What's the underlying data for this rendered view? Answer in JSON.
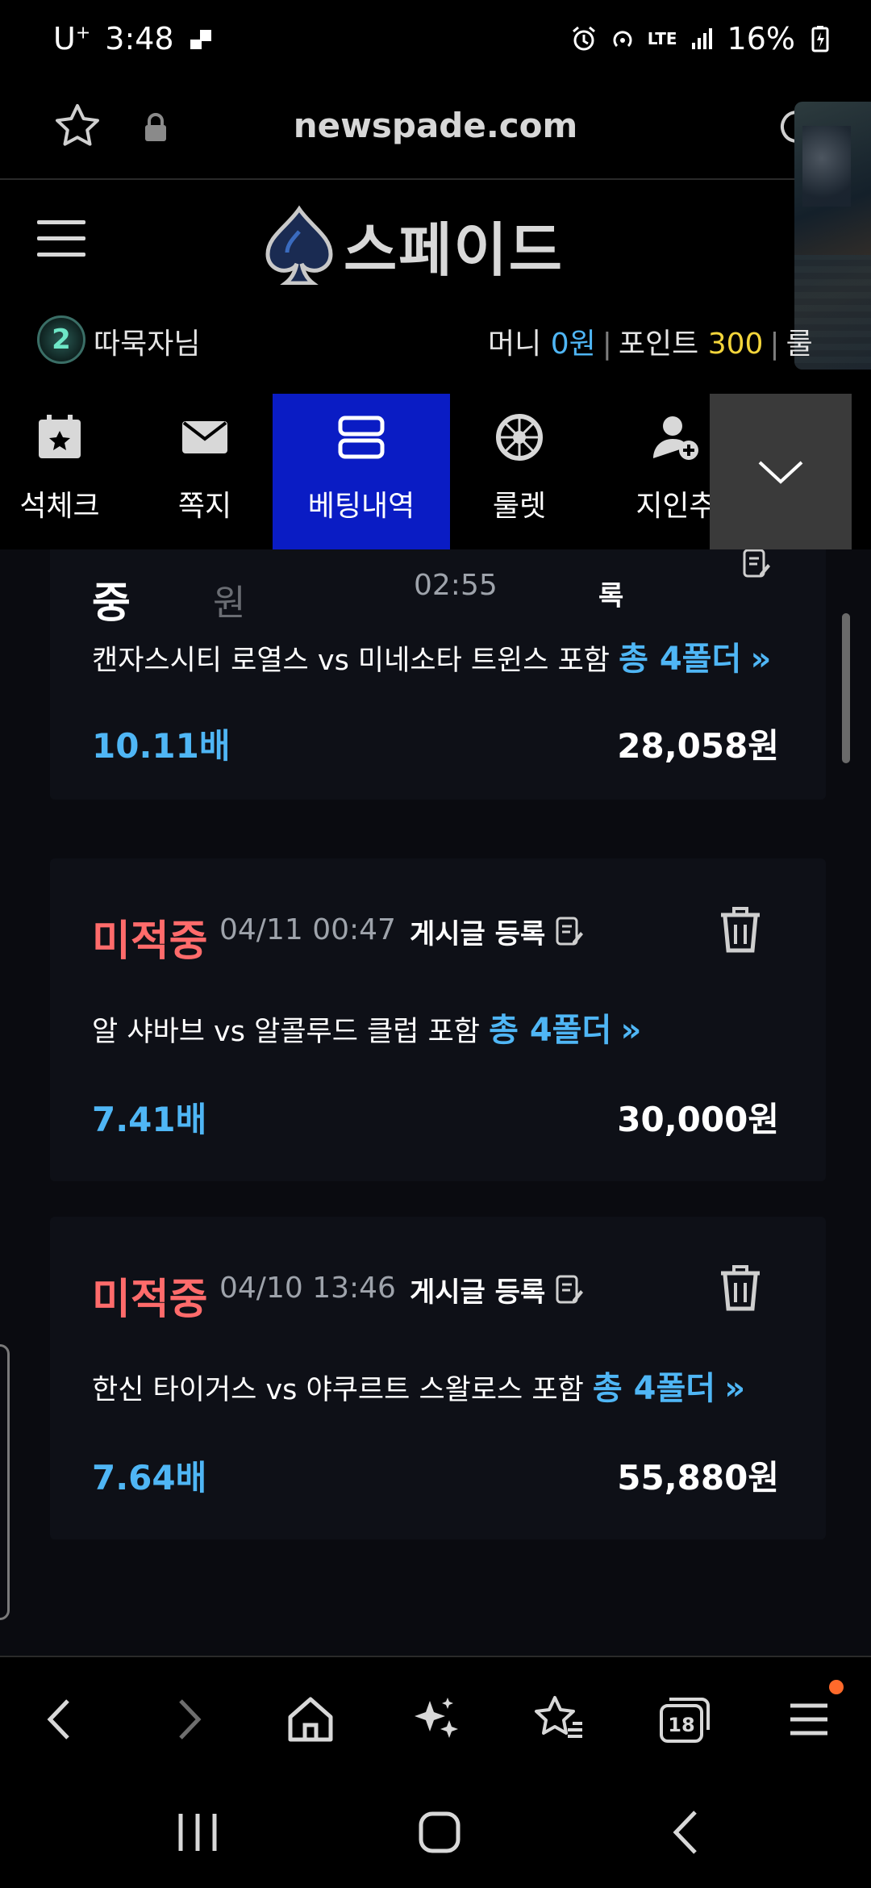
{
  "status_bar": {
    "carrier": "U",
    "carrier_sup": "+",
    "time": "3:48",
    "network": "LTE",
    "battery": "16%"
  },
  "url_bar": {
    "url": "newspade.com"
  },
  "header": {
    "logo_text": "스페이드"
  },
  "user": {
    "badge": "2",
    "name": "따묵자님",
    "money_label": "머니",
    "money_value": "0원",
    "point_label": "포인트",
    "point_value": "300",
    "extra_label": "룰"
  },
  "menu": {
    "items": [
      {
        "label": "석체크",
        "icon": "calendar-star-icon"
      },
      {
        "label": "쪽지",
        "icon": "envelope-icon"
      },
      {
        "label": "베팅내역",
        "icon": "list-icon"
      },
      {
        "label": "룰렛",
        "icon": "roulette-icon"
      },
      {
        "label": "지인추",
        "icon": "add-user-icon"
      }
    ],
    "active_index": 2
  },
  "cards": [
    {
      "status_partial": "중",
      "amount_partial": "원",
      "time_partial": "02:55",
      "post_partial": "록",
      "match": "캔자스시티 로열스 vs 미네소타 트윈스 포함",
      "folder": "총 4폴더",
      "odds": "10.11배",
      "amount": "28,058원"
    },
    {
      "status": "미적중",
      "date": "04/11 00:47",
      "post_label": "게시글 등록",
      "match": "알 샤바브 vs 알콜루드 클럽 포함",
      "folder": "총 4폴더",
      "odds": "7.41배",
      "amount": "30,000원"
    },
    {
      "status": "미적중",
      "date": "04/10 13:46",
      "post_label": "게시글 등록",
      "match": "한신 타이거스 vs 야쿠르트 스왈로스 포함",
      "folder": "총 4폴더",
      "odds": "7.64배",
      "amount": "55,880원"
    }
  ],
  "browser_nav": {
    "tabs_count": "18"
  },
  "colors": {
    "accent_blue": "#4fb6f5",
    "miss_red": "#ff6b6b",
    "active_menu": "#0a1cc4",
    "point_yellow": "#f3d53b"
  }
}
